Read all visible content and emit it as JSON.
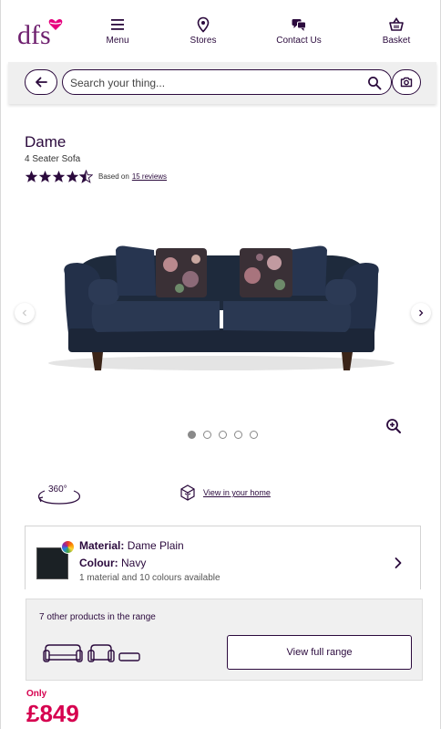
{
  "header": {
    "logo_text": "dfs",
    "nav": [
      {
        "label": "Menu",
        "icon": "menu-icon"
      },
      {
        "label": "Stores",
        "icon": "location-pin-icon"
      },
      {
        "label": "Contact Us",
        "icon": "chat-icon"
      },
      {
        "label": "Basket",
        "icon": "basket-icon"
      }
    ]
  },
  "search": {
    "placeholder": "Search your thing...",
    "value": ""
  },
  "product": {
    "name": "Dame",
    "subtitle": "4 Seater Sofa",
    "rating": 4.5,
    "rating_prefix": "Based on",
    "reviews_link": "15 reviews"
  },
  "gallery": {
    "image_count": 5,
    "active_index": 0
  },
  "features": {
    "view360_label": "360°",
    "view_in_home_label": "View in your home"
  },
  "material": {
    "material_label": "Material:",
    "material_value": "Dame Plain",
    "colour_label": "Colour:",
    "colour_value": "Navy",
    "availability": "1 material and 10 colours available",
    "swatch_color": "#1b2125"
  },
  "range": {
    "text": "7 other products in the range",
    "button_label": "View full range"
  },
  "price": {
    "label": "Only",
    "value": "£849"
  },
  "colors": {
    "brand_purple": "#2b0a3d",
    "brand_pink": "#d6004f"
  }
}
